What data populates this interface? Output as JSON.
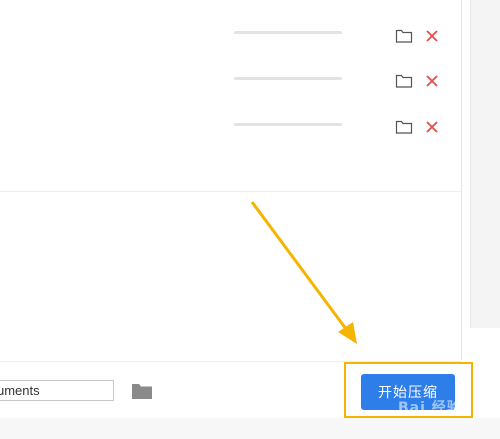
{
  "file_rows": [
    {
      "id": "row-1"
    },
    {
      "id": "row-2"
    },
    {
      "id": "row-3"
    }
  ],
  "output": {
    "path_value": "uments"
  },
  "actions": {
    "start_label": "开始压缩"
  },
  "watermark": {
    "text": "Bai 经验"
  },
  "colors": {
    "accent": "#2d7ee8",
    "remove": "#e84b4b",
    "annotation": "#f5b400",
    "track": "#e3e3e3"
  },
  "icons": {
    "row_folder": "folder-icon",
    "row_remove": "close-icon",
    "browse": "folder-icon"
  }
}
